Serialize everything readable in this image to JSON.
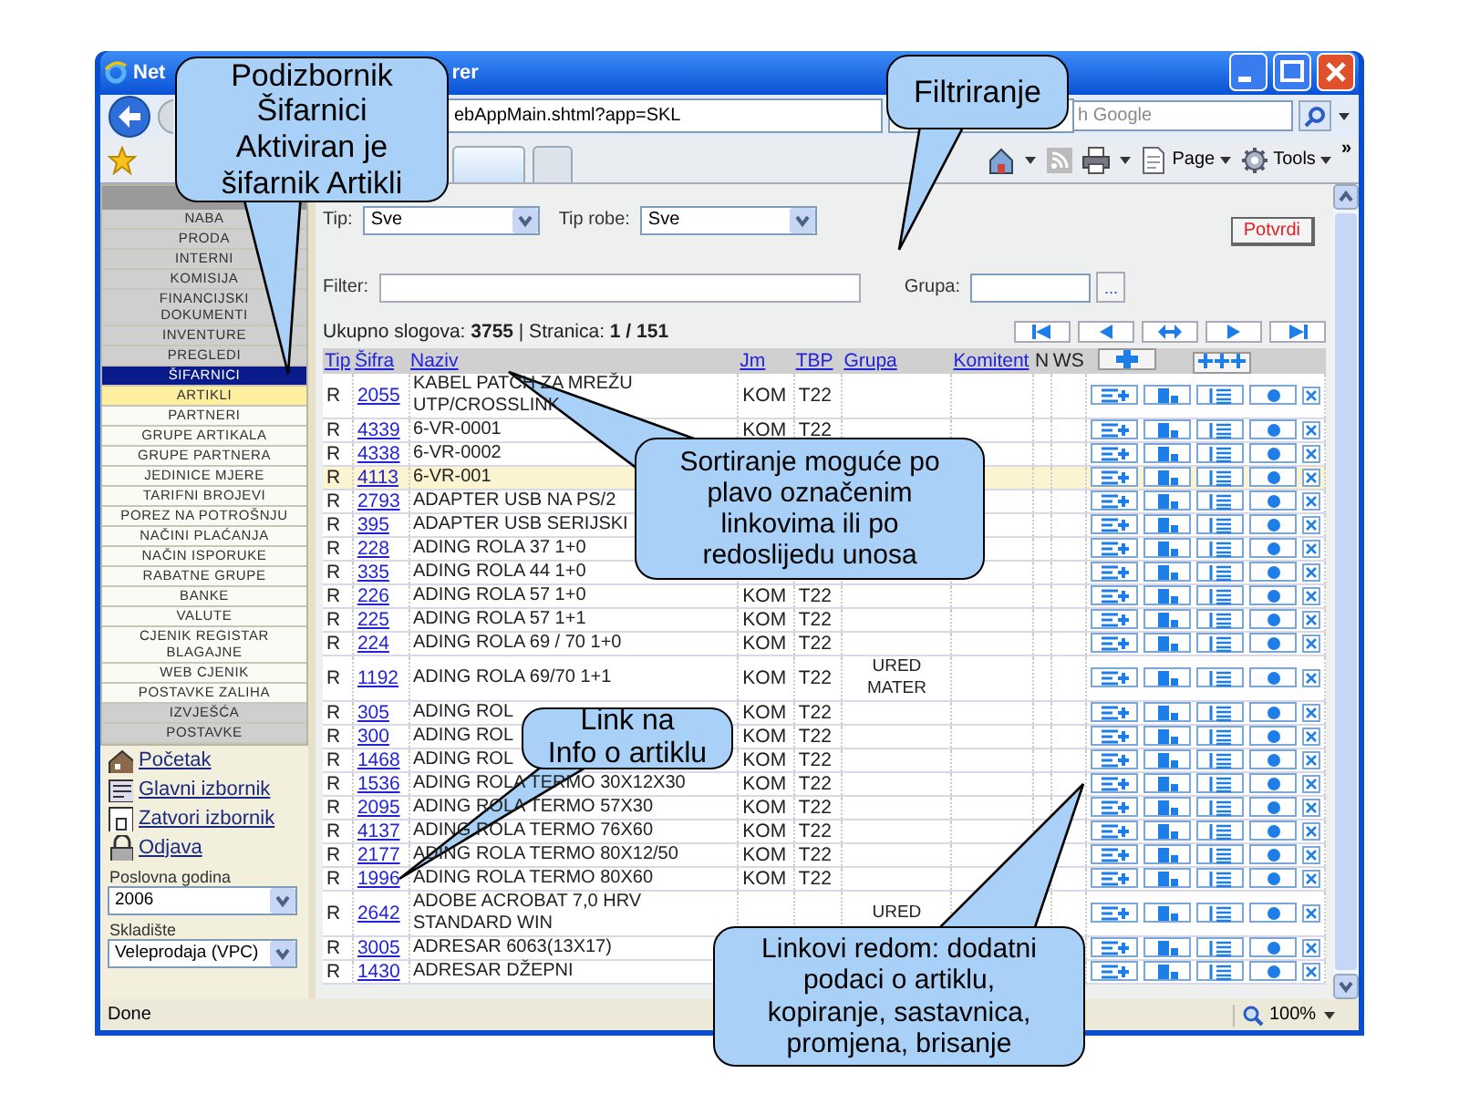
{
  "window": {
    "title_start": "Net",
    "title_end": "rer"
  },
  "address_bar": {
    "url": "ebAppMain.shtml?app=SKL",
    "search": {
      "placeholder": "h Google"
    }
  },
  "toolbar": {
    "items": [
      {
        "kind": "home"
      },
      {
        "kind": "feed"
      },
      {
        "kind": "print"
      },
      {
        "kind": "page",
        "label": "Page"
      },
      {
        "kind": "tools",
        "label": "Tools"
      }
    ],
    "overflow": "»"
  },
  "sidebar": {
    "menu": [
      {
        "label": "NABA",
        "kind": "section",
        "selected": false
      },
      {
        "label": "PRODA",
        "kind": "section",
        "selected": false
      },
      {
        "label": "INTERNI",
        "kind": "section",
        "selected": false
      },
      {
        "label": "KOMISIJA",
        "kind": "section",
        "selected": false
      },
      {
        "label": "FINANCIJSKI DOKUMENTI",
        "kind": "section",
        "selected": false
      },
      {
        "label": "INVENTURE",
        "kind": "section",
        "selected": false
      },
      {
        "label": "PREGLEDI",
        "kind": "section",
        "selected": false
      },
      {
        "label": "ŠIFARNICI",
        "kind": "section",
        "selected": true
      },
      {
        "label": "ARTIKLI",
        "kind": "subitem",
        "selected": true
      },
      {
        "label": "PARTNERI",
        "kind": "subitem",
        "selected": false
      },
      {
        "label": "GRUPE ARTIKALA",
        "kind": "subitem",
        "selected": false
      },
      {
        "label": "GRUPE PARTNERA",
        "kind": "subitem",
        "selected": false
      },
      {
        "label": "JEDINICE MJERE",
        "kind": "subitem",
        "selected": false
      },
      {
        "label": "TARIFNI BROJEVI",
        "kind": "subitem",
        "selected": false
      },
      {
        "label": "POREZ NA POTROŠNJU",
        "kind": "subitem",
        "selected": false
      },
      {
        "label": "NAČINI PLAĆANJA",
        "kind": "subitem",
        "selected": false
      },
      {
        "label": "NAČIN ISPORUKE",
        "kind": "subitem",
        "selected": false
      },
      {
        "label": "RABATNE GRUPE",
        "kind": "subitem",
        "selected": false
      },
      {
        "label": "BANKE",
        "kind": "subitem",
        "selected": false
      },
      {
        "label": "VALUTE",
        "kind": "subitem",
        "selected": false
      },
      {
        "label": "CJENIK REGISTAR BLAGAJNE",
        "kind": "subitem",
        "selected": false
      },
      {
        "label": "WEB CJENIK",
        "kind": "subitem",
        "selected": false
      },
      {
        "label": "POSTAVKE ZALIHA",
        "kind": "subitem",
        "selected": false
      },
      {
        "label": "IZVJEŠĆA",
        "kind": "section",
        "selected": false
      },
      {
        "label": "POSTAVKE",
        "kind": "section",
        "selected": false
      }
    ],
    "links": [
      {
        "label": "Početak",
        "kind": "home"
      },
      {
        "label": "Glavni izbornik",
        "kind": "menu"
      },
      {
        "label": "Zatvori izbornik",
        "kind": "close"
      },
      {
        "label": "Odjava",
        "kind": "lock"
      }
    ],
    "fields": [
      {
        "label": "Poslovna godina",
        "value": "2006"
      },
      {
        "label": "Skladište",
        "value": "Veleprodaja (VPC)"
      }
    ]
  },
  "filters": {
    "tip": {
      "label": "Tip:",
      "value": "Sve"
    },
    "tip_robe": {
      "label": "Tip robe:",
      "value": "Sve"
    },
    "confirm": "Potvrdi",
    "filter": {
      "label": "Filter:"
    },
    "grupa": {
      "label": "Grupa:",
      "button": "..."
    },
    "summary": "Ukupno slogova: **3755** | Stranica: **1 / 151**"
  },
  "table": {
    "columns": [
      {
        "label": "Tip",
        "sortable": true
      },
      {
        "label": "Šifra",
        "sortable": true
      },
      {
        "label": "Naziv",
        "sortable": true
      },
      {
        "label": "Jm",
        "sortable": true
      },
      {
        "label": "TBP",
        "sortable": true
      },
      {
        "label": "Grupa",
        "sortable": true
      },
      {
        "label": "Komitent",
        "sortable": true
      },
      {
        "label": "N",
        "sortable": false
      },
      {
        "label": "WS",
        "sortable": false
      }
    ],
    "rows": [
      {
        "tip": "R",
        "sifra": "2055",
        "naziv": "KABEL PATCH ZA MREŽU UTP/CROSSLINK",
        "jm": "KOM",
        "tbp": "T22",
        "selected": false
      },
      {
        "tip": "R",
        "sifra": "4339",
        "naziv": "6-VR-0001",
        "jm": "KOM",
        "tbp": "T22",
        "selected": false
      },
      {
        "tip": "R",
        "sifra": "4338",
        "naziv": "6-VR-0002",
        "selected": false
      },
      {
        "tip": "R",
        "sifra": "4113",
        "naziv": "6-VR-001",
        "selected": true
      },
      {
        "tip": "R",
        "sifra": "2793",
        "naziv": "ADAPTER USB NA PS/2",
        "selected": false
      },
      {
        "tip": "R",
        "sifra": "395",
        "naziv": "ADAPTER USB SERIJSKI",
        "selected": false
      },
      {
        "tip": "R",
        "sifra": "228",
        "naziv": "ADING ROLA 37 1+0",
        "selected": false
      },
      {
        "tip": "R",
        "sifra": "335",
        "naziv": "ADING ROLA 44 1+0",
        "selected": false
      },
      {
        "tip": "R",
        "sifra": "226",
        "naziv": "ADING ROLA 57 1+0",
        "jm": "KOM",
        "tbp": "T22",
        "selected": false
      },
      {
        "tip": "R",
        "sifra": "225",
        "naziv": "ADING ROLA 57 1+1",
        "jm": "KOM",
        "tbp": "T22",
        "selected": false
      },
      {
        "tip": "R",
        "sifra": "224",
        "naziv": "ADING ROLA 69 / 70 1+0",
        "jm": "KOM",
        "tbp": "T22",
        "selected": false
      },
      {
        "tip": "R",
        "sifra": "1192",
        "naziv": "ADING ROLA 69/70 1+1",
        "jm": "KOM",
        "tbp": "T22",
        "grupa": "URED MATER",
        "selected": false
      },
      {
        "tip": "R",
        "sifra": "305",
        "naziv": "ADING ROL",
        "jm": "KOM",
        "tbp": "T22",
        "selected": false
      },
      {
        "tip": "R",
        "sifra": "300",
        "naziv": "ADING ROL",
        "jm": "KOM",
        "tbp": "T22",
        "selected": false
      },
      {
        "tip": "R",
        "sifra": "1468",
        "naziv": "ADING ROL",
        "jm": "KOM",
        "tbp": "T22",
        "selected": false
      },
      {
        "tip": "R",
        "sifra": "1536",
        "naziv": "ADING ROLA TERMO 30X12X30",
        "jm": "KOM",
        "tbp": "T22",
        "selected": false
      },
      {
        "tip": "R",
        "sifra": "2095",
        "naziv": "ADING ROLA TERMO 57X30",
        "jm": "KOM",
        "tbp": "T22",
        "selected": false
      },
      {
        "tip": "R",
        "sifra": "4137",
        "naziv": "ADING ROLA TERMO 76X60",
        "jm": "KOM",
        "tbp": "T22",
        "selected": false
      },
      {
        "tip": "R",
        "sifra": "2177",
        "naziv": "ADING ROLA TERMO 80X12/50",
        "jm": "KOM",
        "tbp": "T22",
        "selected": false
      },
      {
        "tip": "R",
        "sifra": "1996",
        "naziv": "ADING ROLA TERMO 80X60",
        "jm": "KOM",
        "tbp": "T22",
        "selected": false
      },
      {
        "tip": "R",
        "sifra": "2642",
        "naziv": "ADOBE ACROBAT 7,0 HRV STANDARD WIN",
        "grupa": "URED",
        "selected": false
      },
      {
        "tip": "R",
        "sifra": "3005",
        "naziv": "ADRESAR 6063(13X17)",
        "selected": false
      },
      {
        "tip": "R",
        "sifra": "1430",
        "naziv": "ADRESAR DŽEPNI",
        "selected": false
      }
    ]
  },
  "status_bar": {
    "text": "Done",
    "zoom": "100%"
  },
  "callouts": [
    {
      "lines": [
        "Podizbornik",
        "Šifarnici",
        "Aktiviran je",
        "šifarnik Artikli"
      ]
    },
    {
      "lines": [
        "Filtriranje"
      ]
    },
    {
      "lines": [
        "Sortiranje moguće po",
        "plavo označenim",
        "linkovima ili po",
        "redoslijedu unosa"
      ]
    },
    {
      "lines": [
        "Link na",
        "Info o artiklu"
      ]
    },
    {
      "lines": [
        "Linkovi redom: dodatni",
        "podaci o artiklu,",
        "kopiranje, sastavnica,",
        "promjena, brisanje"
      ]
    }
  ]
}
